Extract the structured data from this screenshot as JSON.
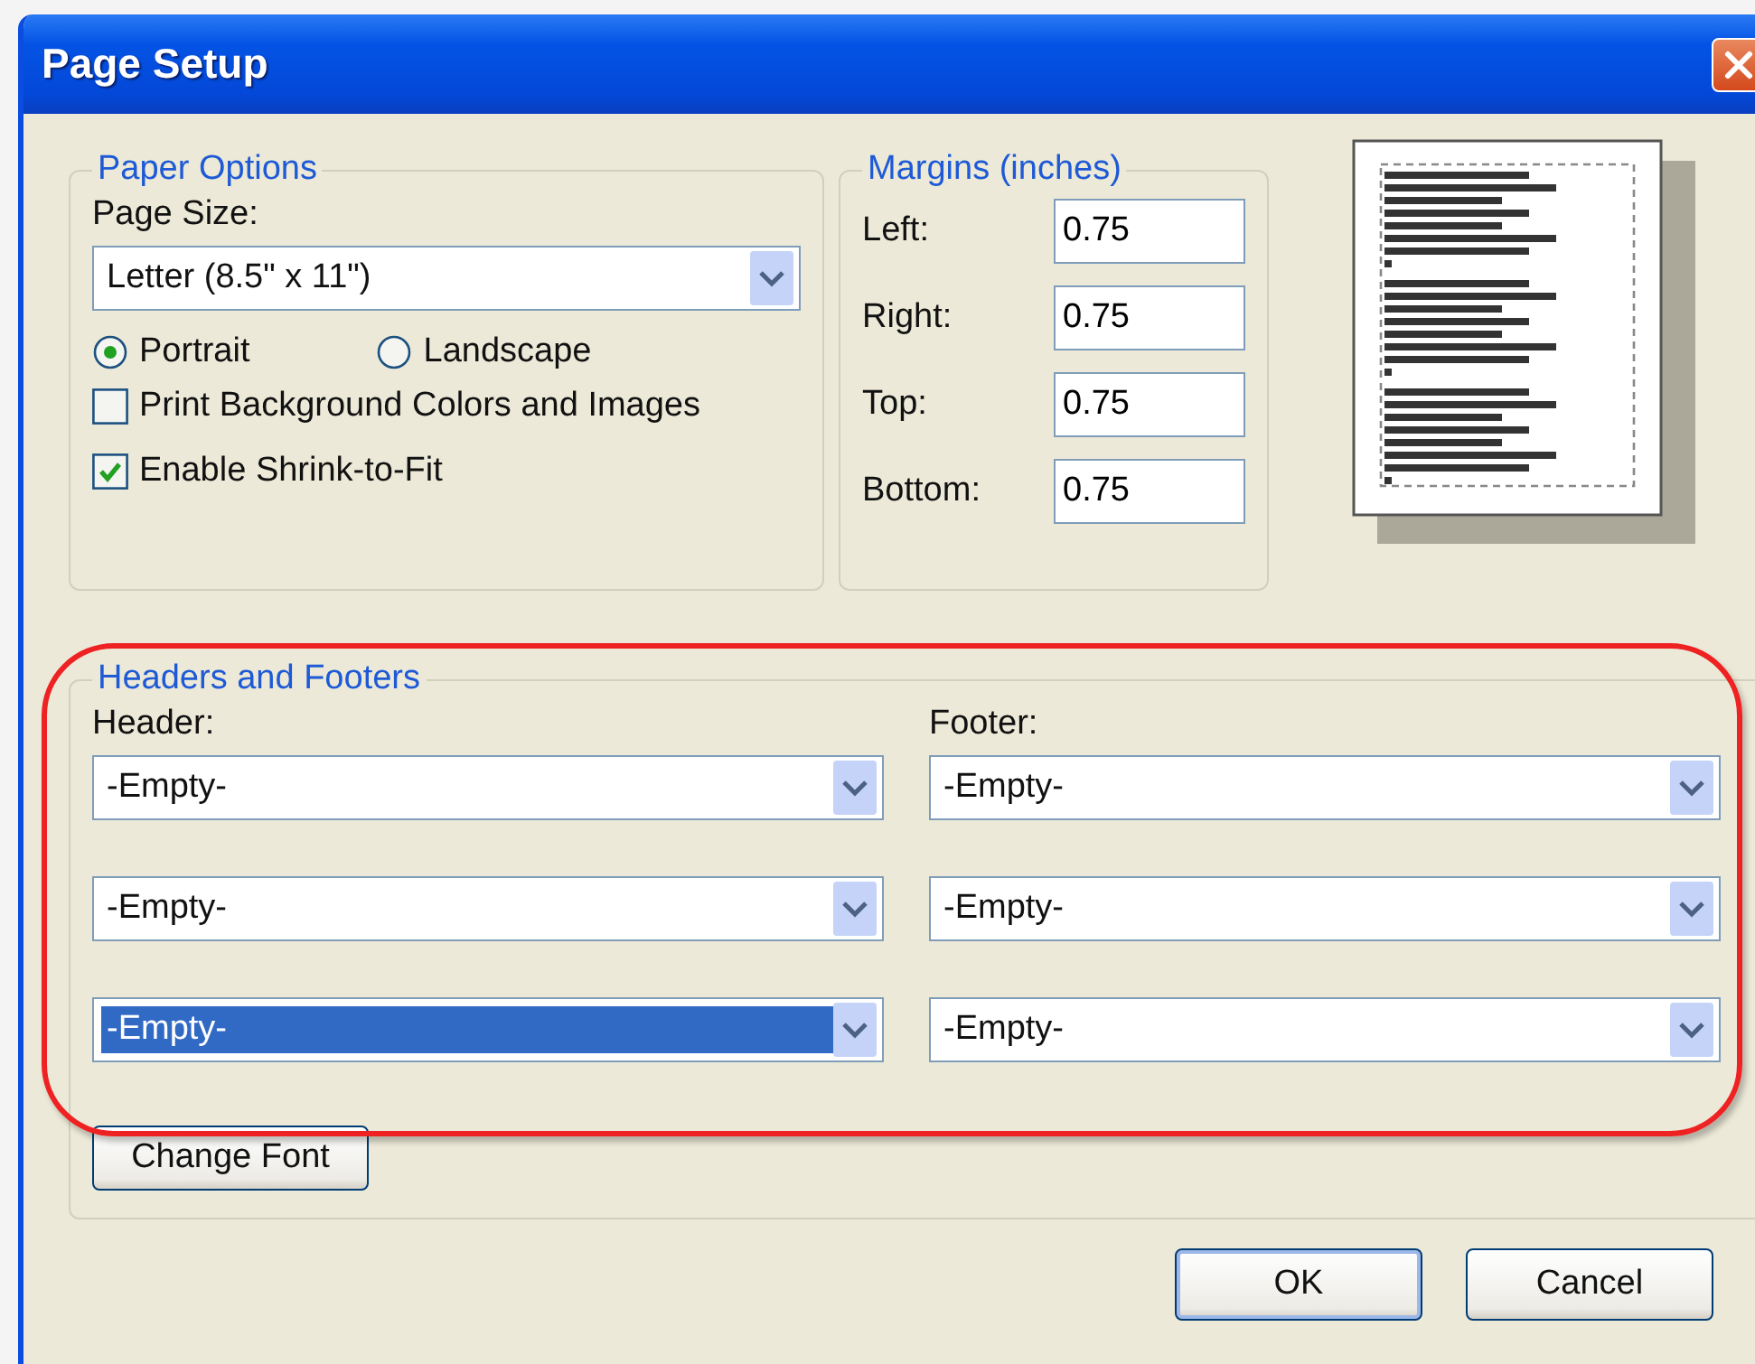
{
  "window": {
    "title": "Page Setup"
  },
  "paper_options": {
    "title": "Paper Options",
    "page_size_label": "Page Size:",
    "page_size": {
      "value": "Letter (8.5\" x 11\")"
    },
    "orientation": [
      {
        "label": "Portrait",
        "selected": true
      },
      {
        "label": "Landscape",
        "selected": false
      }
    ],
    "options": [
      {
        "label": "Print Background Colors and Images",
        "checked": false
      },
      {
        "label": "Enable Shrink-to-Fit",
        "checked": true
      }
    ]
  },
  "margins": {
    "title": "Margins (inches)",
    "fields": [
      {
        "label": "Left:",
        "value": "0.75"
      },
      {
        "label": "Right:",
        "value": "0.75"
      },
      {
        "label": "Top:",
        "value": "0.75"
      },
      {
        "label": "Bottom:",
        "value": "0.75"
      }
    ]
  },
  "headers_and_footers": {
    "title": "Headers and Footers",
    "highlighted": true,
    "header": {
      "label": "Header:",
      "fields": [
        {
          "value": "-Empty-",
          "selected": false
        },
        {
          "value": "-Empty-",
          "selected": false
        },
        {
          "value": "-Empty-",
          "selected": true
        }
      ]
    },
    "footer": {
      "label": "Footer:",
      "fields": [
        {
          "value": "-Empty-",
          "selected": false
        },
        {
          "value": "-Empty-",
          "selected": false
        },
        {
          "value": "-Empty-",
          "selected": false
        }
      ]
    },
    "change_font_button": "Change Font"
  },
  "buttons": [
    "OK",
    "Cancel"
  ]
}
